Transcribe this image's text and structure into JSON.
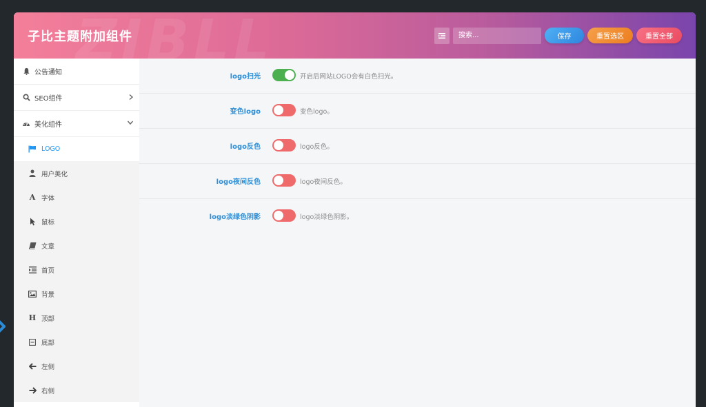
{
  "header": {
    "title": "子比主题附加组件",
    "watermark": "ZIBLL",
    "search_placeholder": "搜索...",
    "save_label": "保存",
    "reset_section_label": "重置选区",
    "reset_all_label": "重置全部"
  },
  "sidebar": {
    "items": [
      {
        "label": "公告通知",
        "icon": "bell-icon"
      },
      {
        "label": "SEO组件",
        "icon": "search-icon"
      },
      {
        "label": "美化组件",
        "icon": "palette-icon"
      }
    ],
    "sub_items": [
      {
        "label": "LOGO",
        "icon": "flag-icon"
      },
      {
        "label": "用户美化",
        "icon": "user-icon"
      },
      {
        "label": "字体",
        "icon": "font-icon"
      },
      {
        "label": "鼠标",
        "icon": "cursor-icon"
      },
      {
        "label": "文章",
        "icon": "book-icon"
      },
      {
        "label": "首页",
        "icon": "indent-icon"
      },
      {
        "label": "背景",
        "icon": "image-icon"
      },
      {
        "label": "顶部",
        "icon": "header-icon"
      },
      {
        "label": "底部",
        "icon": "footer-icon"
      },
      {
        "label": "左侧",
        "icon": "arrow-left-icon"
      },
      {
        "label": "右侧",
        "icon": "arrow-right-icon"
      }
    ]
  },
  "settings": [
    {
      "label": "logo扫光",
      "desc": "开启后网站LOGO会有白色扫光。",
      "enabled": true
    },
    {
      "label": "变色logo",
      "desc": "变色logo。",
      "enabled": false
    },
    {
      "label": "logo反色",
      "desc": "logo反色。",
      "enabled": false
    },
    {
      "label": "logo夜间反色",
      "desc": "logo夜间反色。",
      "enabled": false
    },
    {
      "label": "logo淡绿色阴影",
      "desc": "logo淡绿色阴影。",
      "enabled": false
    }
  ],
  "colors": {
    "accent": "#2196f3",
    "toggle_on": "#4caf50",
    "toggle_off": "#ef6b6b"
  }
}
